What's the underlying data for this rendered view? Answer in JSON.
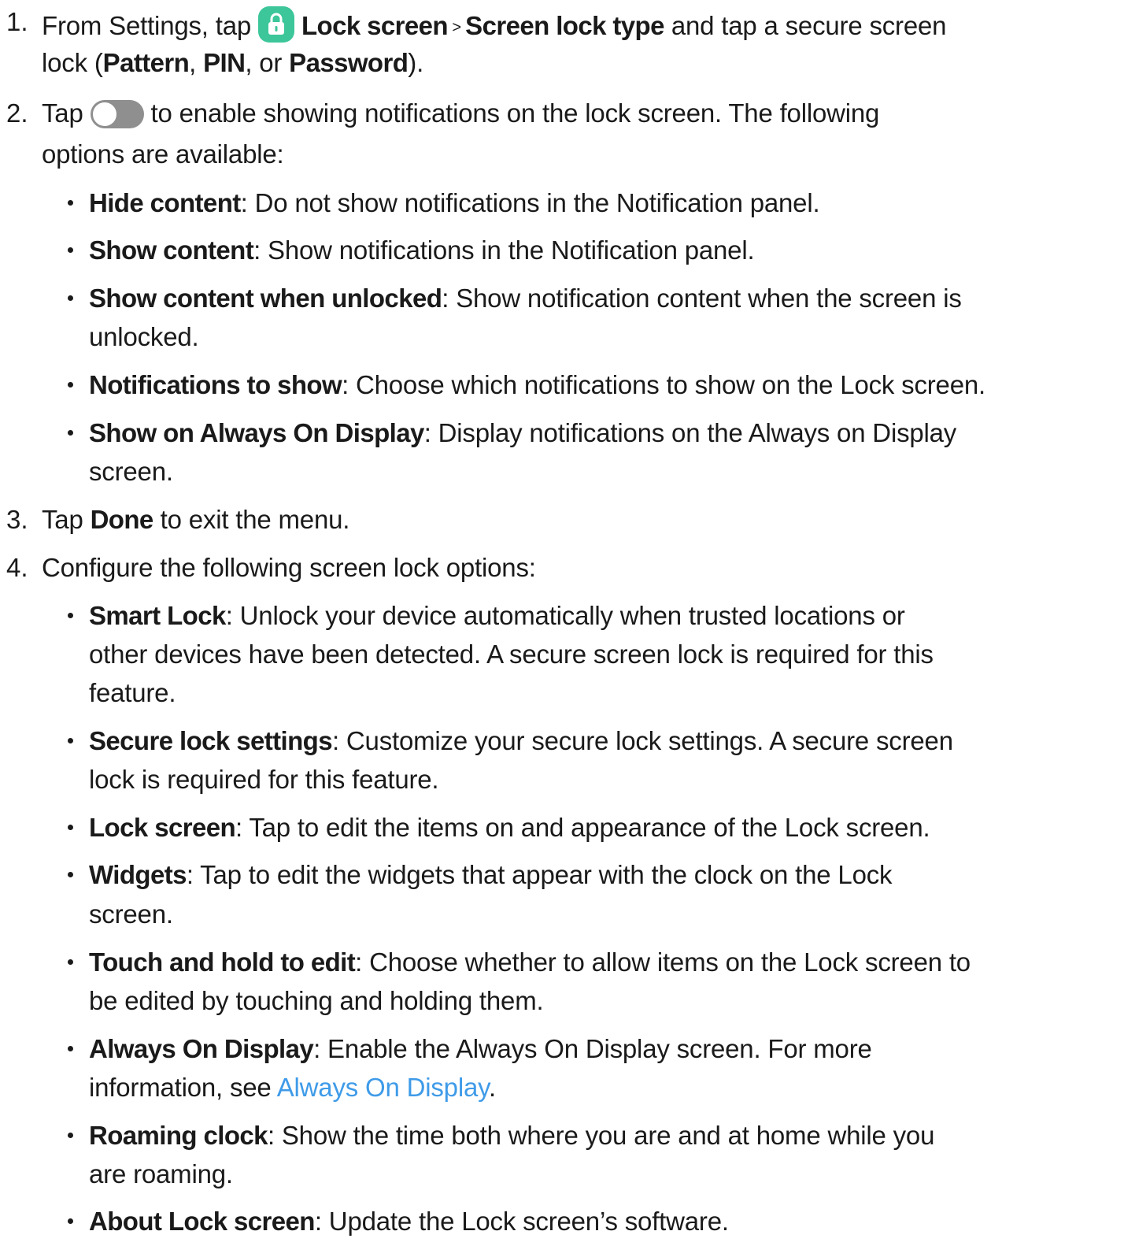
{
  "steps": [
    {
      "num": "1.",
      "lines": [
        [
          "From Settings, tap",
          "Lock screen",
          " > ",
          "Screen lock type",
          " and tap a secure screen"
        ],
        [
          "lock (",
          "Pattern",
          ", ",
          "PIN",
          ", or ",
          "Password",
          ")."
        ]
      ]
    },
    {
      "num": "2.",
      "lines": [
        [
          "Tap",
          "to enable showing notifications on the lock screen. The following"
        ],
        [
          "options are available:"
        ]
      ],
      "bullets": [
        {
          "term": "Hide content",
          "lines": [
            ": Do not show notifications in the Notification panel."
          ]
        },
        {
          "term": "Show content",
          "lines": [
            ": Show notifications in the Notification panel."
          ]
        },
        {
          "term": "Show content when unlocked",
          "lines": [
            ": Show notification content when the screen is",
            "unlocked."
          ]
        },
        {
          "term": "Notifications to show",
          "lines": [
            ": Choose which notifications to show on the Lock screen."
          ]
        },
        {
          "term": "Show on Always On Display",
          "lines": [
            ": Display notifications on the Always on Display",
            "screen."
          ]
        }
      ]
    },
    {
      "num": "3.",
      "lines": [
        [
          "Tap ",
          "Done",
          " to exit the menu."
        ]
      ]
    },
    {
      "num": "4.",
      "lines": [
        [
          "Configure the following screen lock options:"
        ]
      ],
      "bullets": [
        {
          "term": "Smart Lock",
          "lines": [
            ": Unlock your device automatically when trusted locations or",
            "other devices have been detected. A secure screen lock is required for this",
            "feature."
          ]
        },
        {
          "term": "Secure lock settings",
          "lines": [
            ": Customize your secure lock settings. A secure screen",
            "lock is required for this feature."
          ]
        },
        {
          "term": "Lock screen",
          "lines": [
            ": Tap to edit the items on and appearance of the Lock screen."
          ]
        },
        {
          "term": "Widgets",
          "lines": [
            ": Tap to edit the widgets that appear with the clock on the Lock",
            "screen."
          ]
        },
        {
          "term": "Touch and hold to edit",
          "lines": [
            ": Choose whether to allow items on the Lock screen to",
            "be edited by touching and holding them."
          ]
        },
        {
          "term": "Always On Display",
          "lines": [
            ": Enable the Always On Display screen. For more",
            "information, see ",
            "Always On Display",
            "."
          ]
        },
        {
          "term": "Roaming clock",
          "lines": [
            ": Show the time both where you are and at home while you",
            "are roaming."
          ]
        },
        {
          "term": "About Lock screen",
          "lines": [
            ": Update the Lock screen’s software."
          ]
        }
      ]
    }
  ],
  "icons": {
    "lock_icon": "lock-icon",
    "toggle_icon": "toggle-off-icon",
    "lock_icon_color": "#3cc69a",
    "link_color": "#3f9be8"
  }
}
